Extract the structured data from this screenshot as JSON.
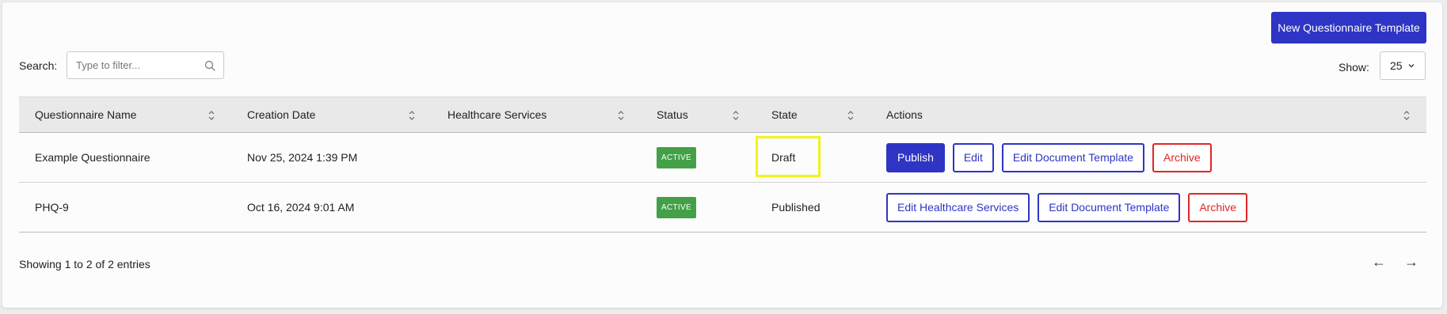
{
  "header": {
    "new_button_label": "New Questionnaire Template"
  },
  "search": {
    "label": "Search:",
    "placeholder": "Type to filter..."
  },
  "show": {
    "label": "Show:",
    "value": "25"
  },
  "table": {
    "columns": [
      "Questionnaire Name",
      "Creation Date",
      "Healthcare Services",
      "Status",
      "State",
      "Actions"
    ],
    "rows": [
      {
        "name": "Example Questionnaire",
        "created": "Nov 25, 2024 1:39 PM",
        "services": "",
        "status": "ACTIVE",
        "state": "Draft",
        "actions": [
          "Publish",
          "Edit",
          "Edit Document Template",
          "Archive"
        ]
      },
      {
        "name": "PHQ-9",
        "created": "Oct 16, 2024 9:01 AM",
        "services": "",
        "status": "ACTIVE",
        "state": "Published",
        "actions": [
          "Edit Healthcare Services",
          "Edit Document Template",
          "Archive"
        ]
      }
    ]
  },
  "footer": {
    "info": "Showing 1 to 2 of 2 entries",
    "prev": "←",
    "next": "→"
  },
  "colors": {
    "accent": "#2e35c5",
    "danger": "#e02525",
    "active_badge": "#43a047",
    "highlight": "#f2f21a"
  }
}
